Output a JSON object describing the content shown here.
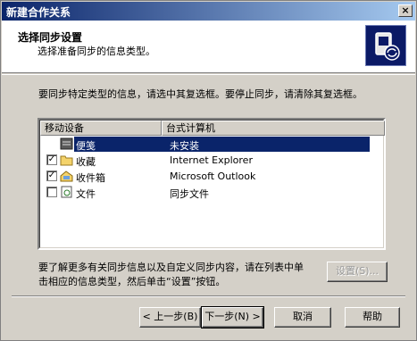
{
  "window": {
    "title": "新建合作关系",
    "close_label": "×"
  },
  "header": {
    "title": "选择同步设置",
    "subtitle": "选择准备同步的信息类型。",
    "icon": "sync-device-icon"
  },
  "instruction": "要同步特定类型的信息，请选中其复选框。要停止同步，请清除其复选框。",
  "list": {
    "columns": [
      "移动设备",
      "台式计算机"
    ],
    "rows": [
      {
        "name": "便笺",
        "app": "未安装",
        "checked": null,
        "selected": true,
        "icon": "note-icon"
      },
      {
        "name": "收藏",
        "app": "Internet Explorer",
        "checked": true,
        "selected": false,
        "icon": "folder-icon"
      },
      {
        "name": "收件箱",
        "app": "Microsoft Outlook",
        "checked": true,
        "selected": false,
        "icon": "inbox-icon"
      },
      {
        "name": "文件",
        "app": "同步文件",
        "checked": false,
        "selected": false,
        "icon": "file-sync-icon"
      }
    ]
  },
  "footer_text": "要了解更多有关同步信息以及自定义同步内容，请在列表中单击相应的信息类型，然后单击“设置”按钮。",
  "buttons": {
    "settings": "设置(S)...",
    "back": "< 上一步(B)",
    "next": "下一步(N) >",
    "cancel": "取消",
    "help": "帮助"
  }
}
